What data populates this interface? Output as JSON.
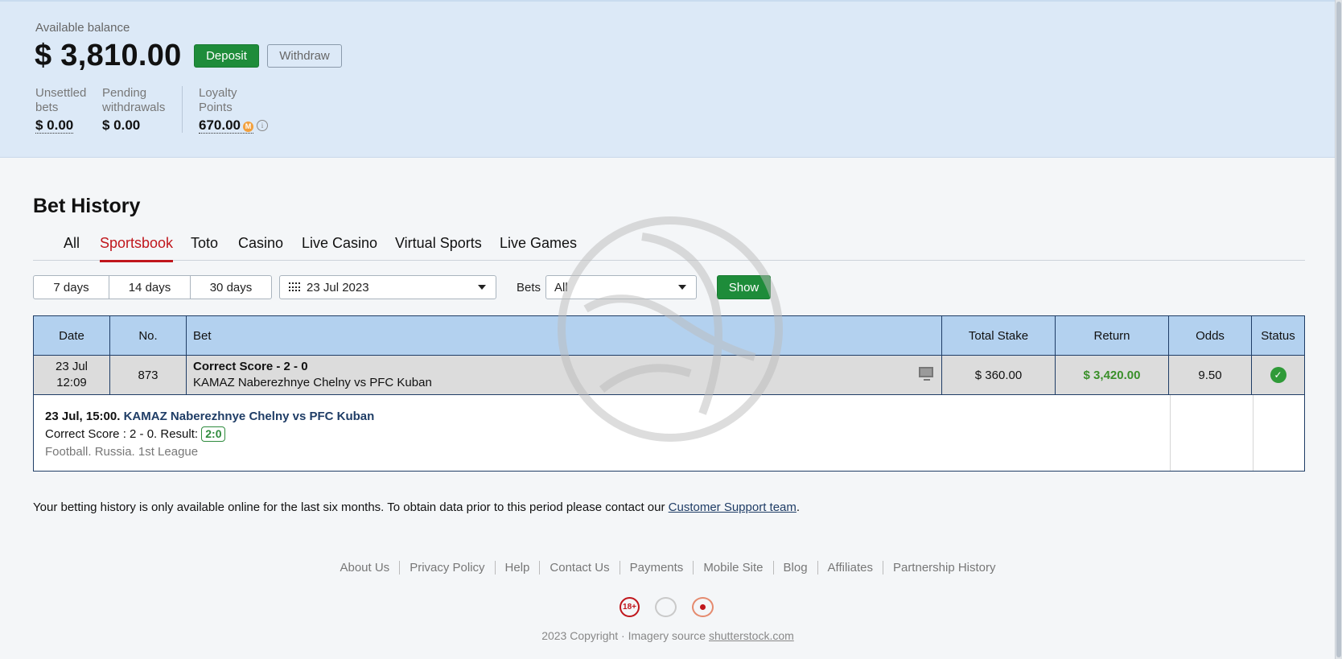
{
  "balance": {
    "label": "Available balance",
    "amount": "$ 3,810.00",
    "deposit_label": "Deposit",
    "withdraw_label": "Withdraw",
    "unsettled": {
      "label_line1": "Unsettled",
      "label_line2": "bets",
      "value": "$ 0.00"
    },
    "pending": {
      "label_line1": "Pending",
      "label_line2": "withdrawals",
      "value": "$ 0.00"
    },
    "loyalty": {
      "label_line1": "Loyalty",
      "label_line2": "Points",
      "value": "670.00",
      "coin_glyph": "M",
      "info_glyph": "i"
    }
  },
  "page_title": "Bet History",
  "tabs": [
    {
      "label": "All",
      "active": false
    },
    {
      "label": "Sportsbook",
      "active": true
    },
    {
      "label": "Toto",
      "active": false
    },
    {
      "label": "Casino",
      "active": false
    },
    {
      "label": "Live Casino",
      "active": false
    },
    {
      "label": "Virtual Sports",
      "active": false
    },
    {
      "label": "Live Games",
      "active": false
    }
  ],
  "filters": {
    "periods": [
      "7 days",
      "14 days",
      "30 days"
    ],
    "date": "23 Jul 2023",
    "bets_label": "Bets",
    "bets_value": "All",
    "show_label": "Show"
  },
  "table": {
    "headers": {
      "date": "Date",
      "no": "No.",
      "bet": "Bet",
      "stake": "Total Stake",
      "return": "Return",
      "odds": "Odds",
      "status": "Status"
    },
    "row": {
      "date_line1": "23 Jul",
      "date_line2": "12:09",
      "no": "873",
      "bet_title": "Correct Score - 2 - 0",
      "bet_match": "KAMAZ Naberezhnye Chelny vs PFC Kuban",
      "stake": "$ 360.00",
      "return": "$ 3,420.00",
      "odds": "9.50",
      "status_glyph": "✓"
    },
    "detail": {
      "time": "23 Jul, 15:00.",
      "match": "KAMAZ Naberezhnye Chelny vs PFC Kuban",
      "selection": "Correct Score : 2 - 0. Result:",
      "result": "2:0",
      "category": "Football. Russia. 1st League"
    }
  },
  "notice": {
    "text": "Your betting history is only available online for the last six months. To obtain data prior to this period please contact our",
    "link": "Customer Support team",
    "end": "."
  },
  "footer": {
    "links": [
      "About Us",
      "Privacy Policy",
      "Help",
      "Contact Us",
      "Payments",
      "Mobile Site",
      "Blog",
      "Affiliates",
      "Partnership History"
    ],
    "badge_18": "18+",
    "copyright": "2023 Copyright · Imagery source",
    "copyright_link": "shutterstock.com"
  },
  "colors": {
    "accent_green": "#1e8c3a",
    "active_tab_red": "#c0161c",
    "header_bg": "#dce9f7",
    "table_head_bg": "#b3d1ef",
    "return_green": "#3a8f2a"
  }
}
